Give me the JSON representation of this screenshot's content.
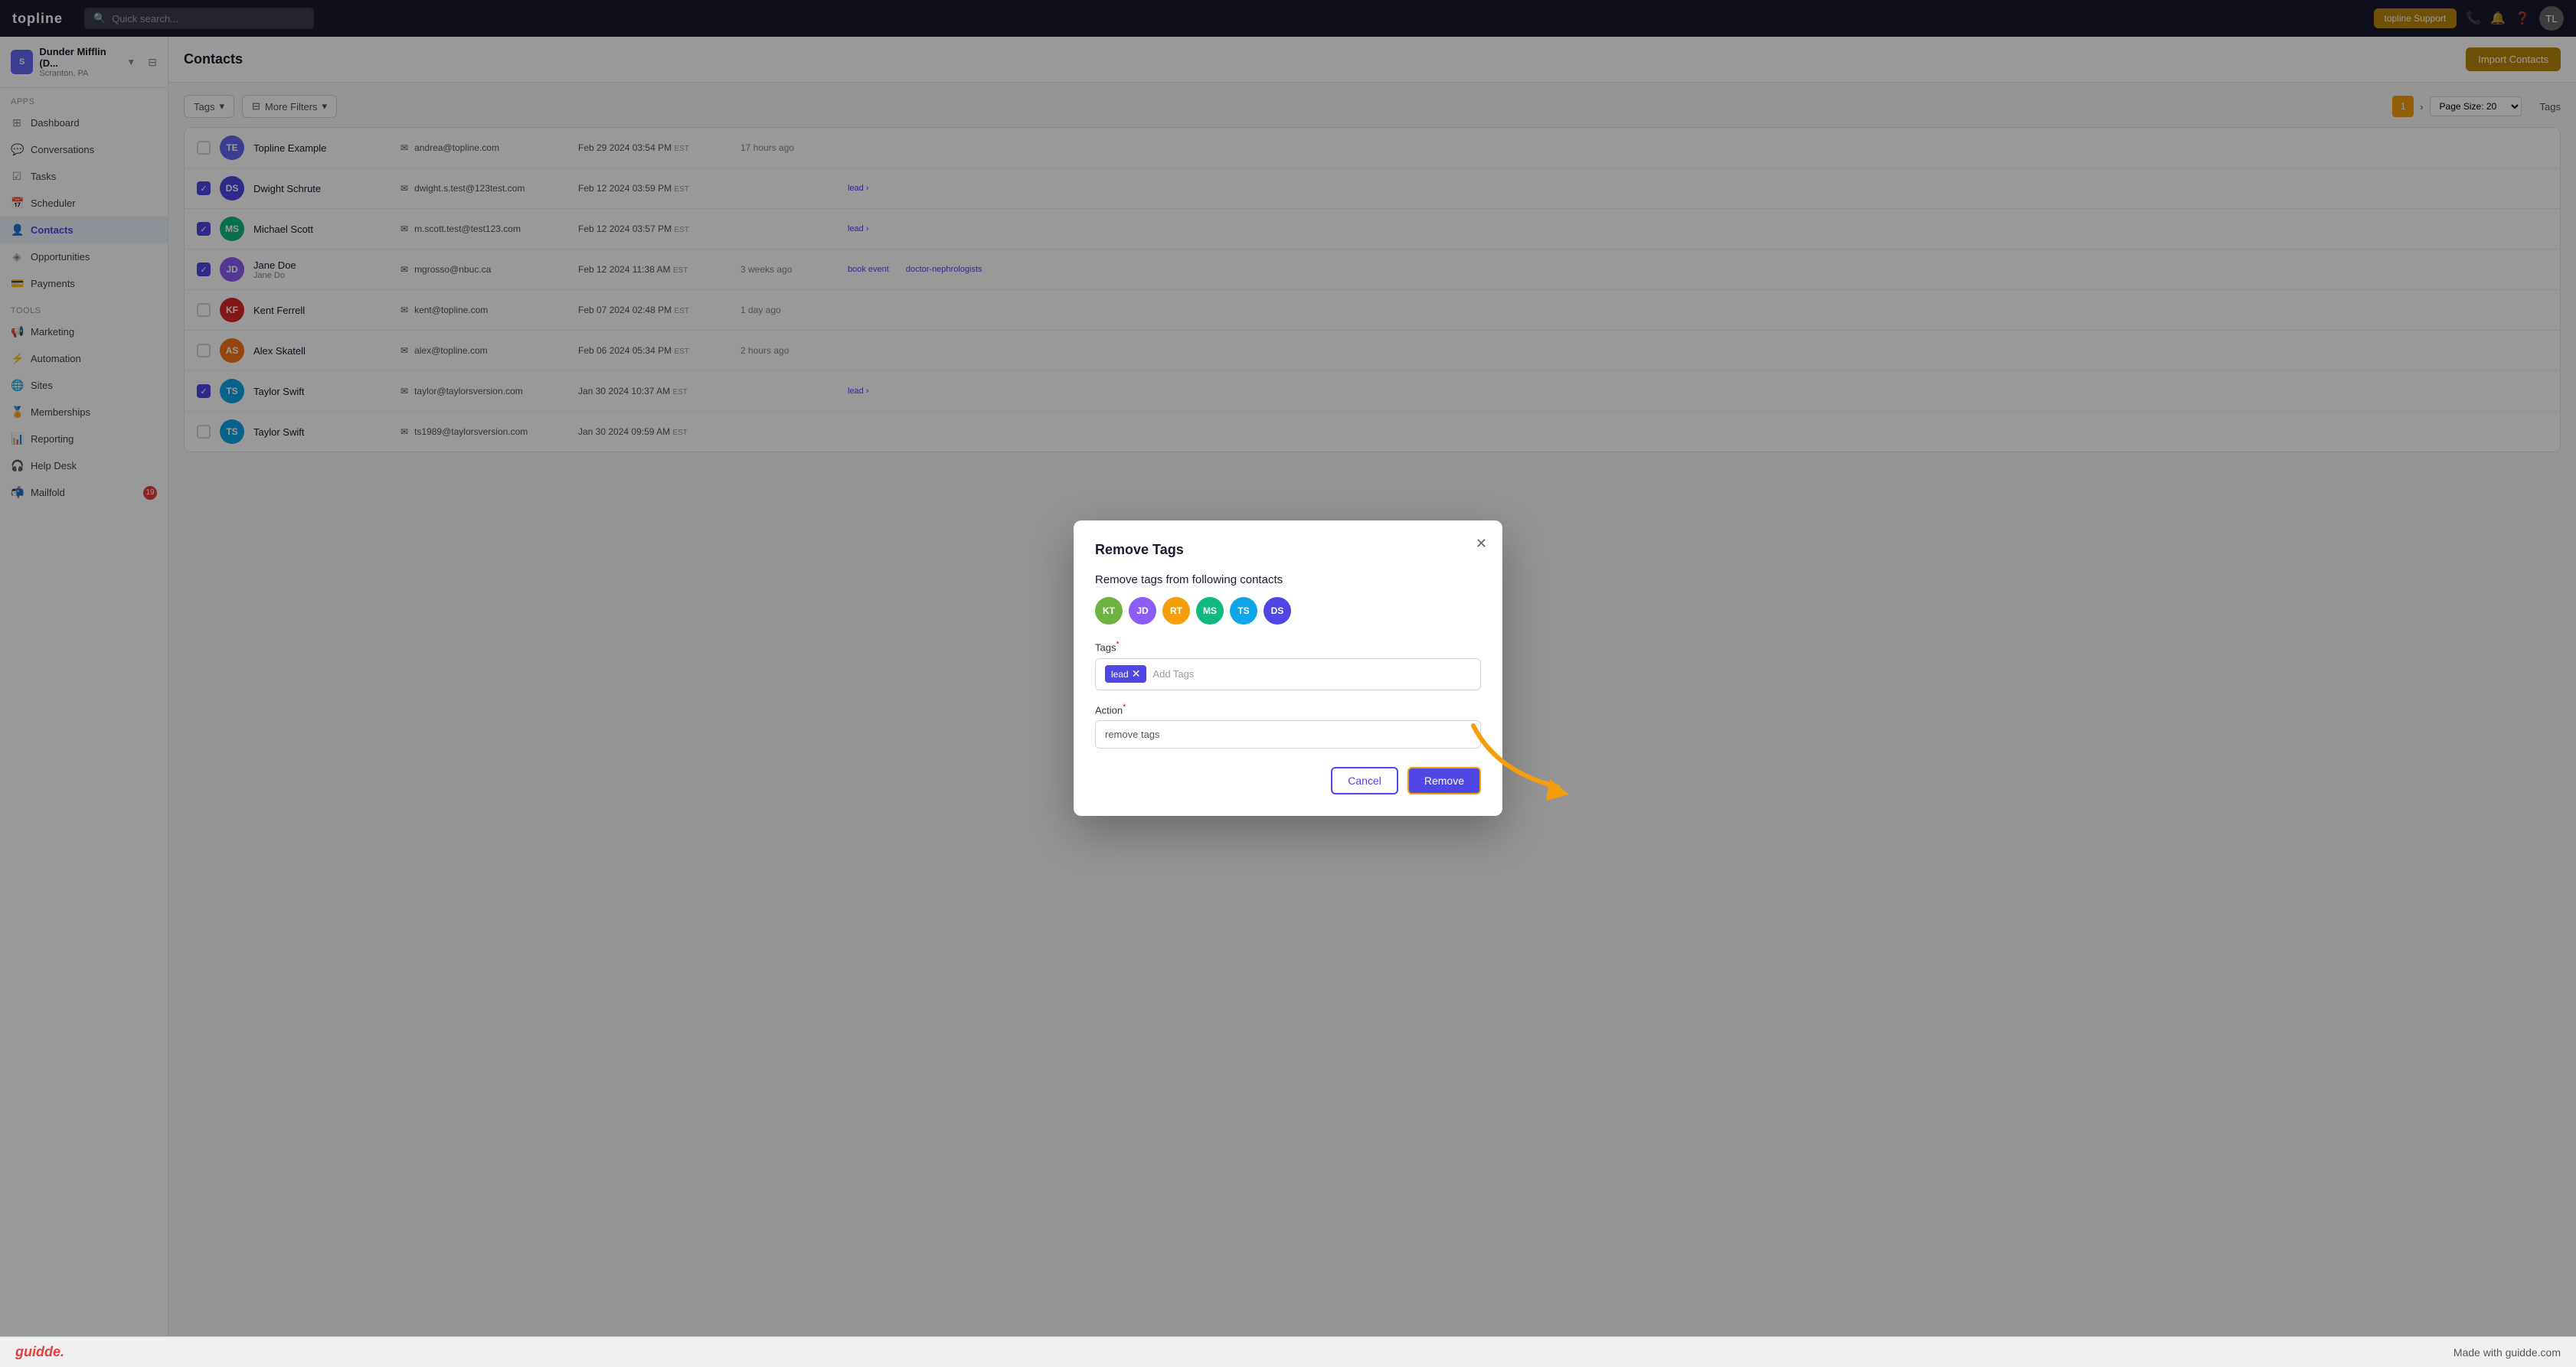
{
  "app": {
    "logo": "topline",
    "title": "Contacts"
  },
  "navbar": {
    "logo": "topline",
    "search_placeholder": "Quick search...",
    "support_btn": "topline Support",
    "avatar_initials": "TL"
  },
  "sidebar": {
    "workspace": {
      "name": "Dunder Mifflin (D...",
      "location": "Scranton, PA",
      "avatar": "S"
    },
    "sections": [
      {
        "label": "Apps",
        "items": [
          {
            "icon": "⊞",
            "label": "Dashboard"
          },
          {
            "icon": "💬",
            "label": "Conversations"
          },
          {
            "icon": "☑",
            "label": "Tasks"
          },
          {
            "icon": "📅",
            "label": "Scheduler"
          },
          {
            "icon": "👤",
            "label": "Contacts",
            "active": true
          },
          {
            "icon": "◈",
            "label": "Opportunities"
          },
          {
            "icon": "💳",
            "label": "Payments"
          }
        ]
      },
      {
        "label": "Tools",
        "items": [
          {
            "icon": "📢",
            "label": "Marketing"
          },
          {
            "icon": "⚡",
            "label": "Automation"
          },
          {
            "icon": "🌐",
            "label": "Sites"
          },
          {
            "icon": "🏅",
            "label": "Memberships"
          },
          {
            "icon": "📊",
            "label": "Reporting"
          },
          {
            "icon": "🎧",
            "label": "Help Desk"
          },
          {
            "icon": "📬",
            "label": "Mailfold",
            "badge": "19"
          }
        ]
      }
    ]
  },
  "contacts_header": {
    "title": "Contacts",
    "import_btn": "Import Contacts"
  },
  "table": {
    "toolbar": {
      "filter_label": "Tags",
      "more_filters": "More Filters",
      "page_current": "1",
      "page_size_label": "Page Size: 20"
    },
    "rows": [
      {
        "initials": "TE",
        "color": "#6366f1",
        "name": "Topline Example",
        "email": "andrea@topline.com",
        "date": "Feb 29 2024 03:54 PM",
        "timezone": "EST",
        "activity": "17 hours ago",
        "tags": [],
        "checked": false
      },
      {
        "initials": "DS",
        "color": "#4f46e5",
        "name": "Dwight Schrute",
        "email": "dwight.s.test@123test.com",
        "date": "Feb 12 2024 03:59 PM",
        "timezone": "EST",
        "activity": "",
        "tags": [
          "lead"
        ],
        "checked": true
      },
      {
        "initials": "MS",
        "color": "#10b981",
        "name": "Michael Scott",
        "email": "m.scott.test@test123.com",
        "date": "Feb 12 2024 03:57 PM",
        "timezone": "EST",
        "activity": "",
        "tags": [
          "lead"
        ],
        "checked": true
      },
      {
        "initials": "JD",
        "color": "#8b5cf6",
        "name": "Jane Doe",
        "sub": "Jane Do",
        "email": "mgrosso@nbuc.ca",
        "date": "Feb 12 2024 11:38 AM",
        "timezone": "EST",
        "activity": "3 weeks ago",
        "tags": [
          "book event",
          "doctor-nephrologists"
        ],
        "checked": true
      },
      {
        "initials": "KF",
        "color": "#dc2626",
        "name": "Kent Ferrell",
        "email": "kent@topline.com",
        "date": "Feb 07 2024 02:48 PM",
        "timezone": "EST",
        "activity": "1 day ago",
        "tags": [],
        "checked": false
      },
      {
        "initials": "AS",
        "color": "#f97316",
        "name": "Alex Skatell",
        "email": "alex@topline.com",
        "date": "Feb 06 2024 05:34 PM",
        "timezone": "EST",
        "activity": "2 hours ago",
        "tags": [],
        "checked": false
      },
      {
        "initials": "TS",
        "color": "#0ea5e9",
        "name": "Taylor Swift",
        "email": "taylor@taylorsversion.com",
        "date": "Jan 30 2024 10:37 AM",
        "timezone": "EST",
        "activity": "",
        "tags": [
          "lead"
        ],
        "checked": true
      },
      {
        "initials": "TS",
        "color": "#0ea5e9",
        "name": "Taylor Swift",
        "email": "ts1989@taylorsversion.com",
        "date": "Jan 30 2024 09:59 AM",
        "timezone": "EST",
        "activity": "",
        "tags": [],
        "checked": false
      }
    ]
  },
  "modal": {
    "title": "Remove Tags",
    "subtitle": "Remove tags from following contacts",
    "contacts": [
      {
        "initials": "KT",
        "color": "#6db33f"
      },
      {
        "initials": "JD",
        "color": "#8b5cf6"
      },
      {
        "initials": "RT",
        "color": "#f59e0b"
      },
      {
        "initials": "MS",
        "color": "#10b981"
      },
      {
        "initials": "TS",
        "color": "#0ea5e9"
      },
      {
        "initials": "DS",
        "color": "#4f46e5"
      }
    ],
    "tags_label": "Tags",
    "tags_required": "*",
    "current_tag": "lead",
    "add_tag_placeholder": "Add Tags",
    "action_label": "Action",
    "action_required": "*",
    "action_value": "remove tags",
    "cancel_btn": "Cancel",
    "remove_btn": "Remove"
  },
  "bottom_bar": {
    "logo": "guidde.",
    "tagline": "Made with guidde.com"
  }
}
